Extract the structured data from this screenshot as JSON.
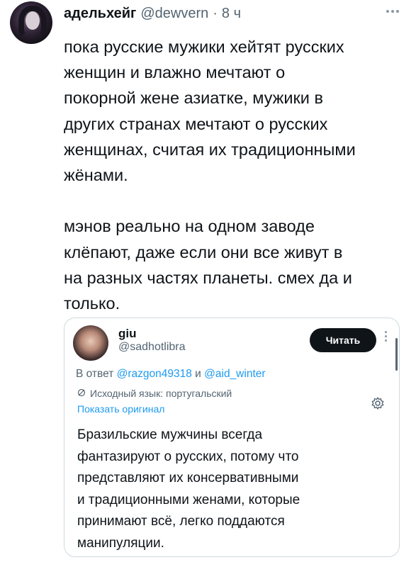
{
  "post": {
    "author_name": "адельхейг",
    "author_handle": "@dewvern",
    "separator": "·",
    "timestamp": "8 ч",
    "text_lines": [
      "пока русские мужики хейтят русских",
      "женщин и влажно мечтают о",
      "покорной жене азиатке, мужики в",
      "других странах мечтают о русских",
      "женщинах, считая их традиционными",
      "жёнами.",
      "",
      "мэнов реально на одном заводе",
      "клёпают, даже если они все живут в",
      "на разных частях планеты. смех да и",
      "только."
    ]
  },
  "quoted": {
    "author_name": "giu",
    "author_handle": "@sadhotlibra",
    "follow_label": "Читать",
    "reply_prefix": "В ответ",
    "reply_mention_1": "@razgon49318",
    "reply_and": "и",
    "reply_mention_2": "@aid_winter",
    "translated_from": "Исходный язык: португальский",
    "show_original": "Показать оригинал",
    "text_lines": [
      "Бразильские мужчины всегда",
      "фантазируют о русских, потому что",
      "представляют их консервативными",
      "и традиционными женами, которые",
      "принимают всё, легко поддаются",
      "манипуляции."
    ]
  },
  "icons": {
    "more": "more-horizontal-icon",
    "translate": "translate-icon",
    "settings": "gear-icon"
  },
  "colors": {
    "text": "#0f1419",
    "secondary": "#536471",
    "link": "#1d9bf0",
    "follow_bg": "#0f1419",
    "border": "#cfd9de"
  }
}
